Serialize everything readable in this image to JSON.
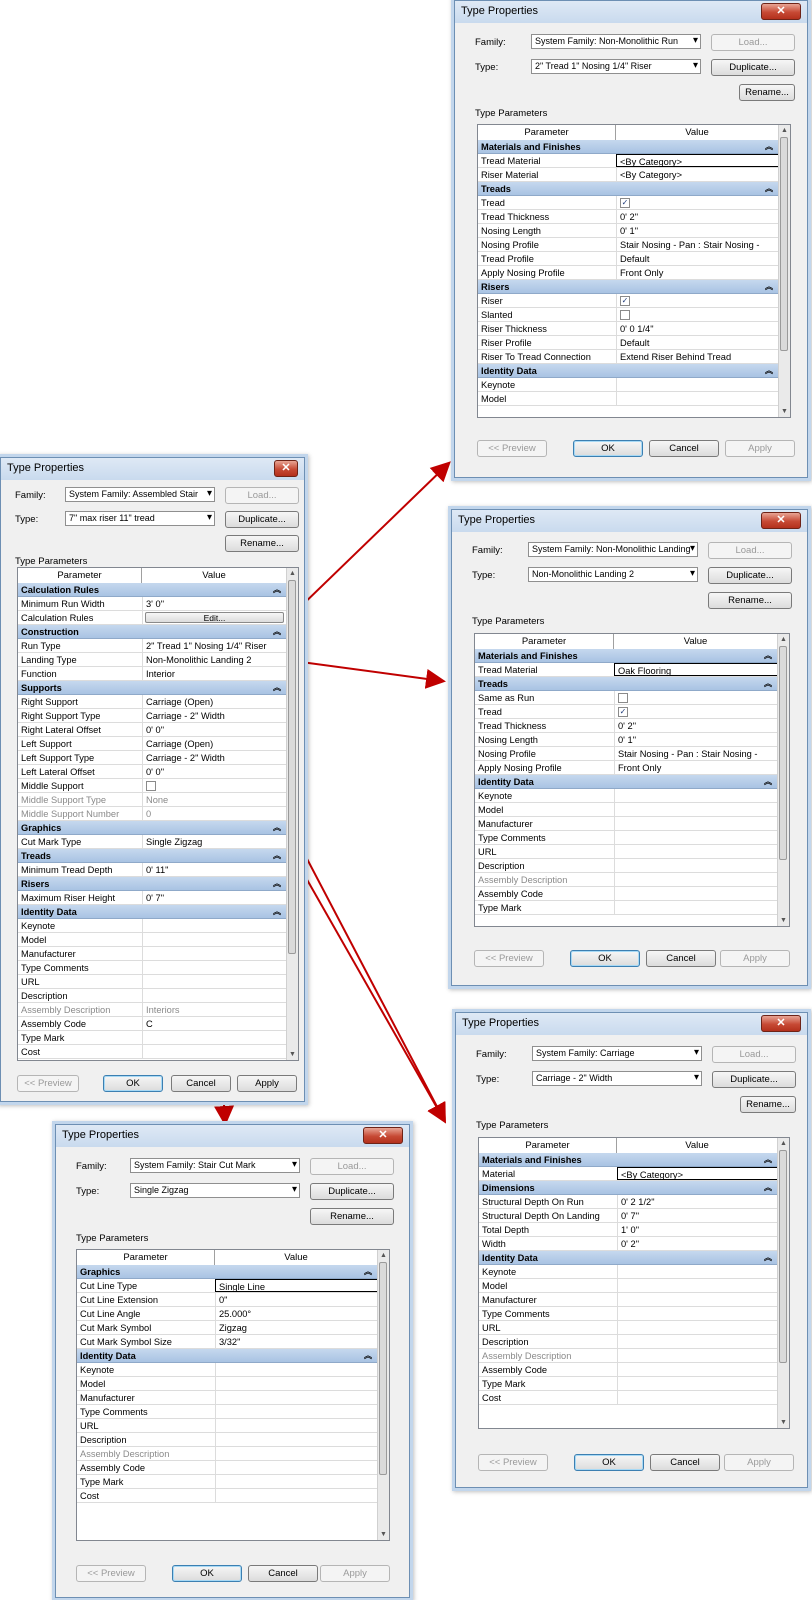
{
  "common": {
    "title": "Type Properties",
    "close_glyph": "✕",
    "family_label": "Family:",
    "type_label": "Type:",
    "load": "Load...",
    "duplicate": "Duplicate...",
    "rename": "Rename...",
    "type_parameters": "Type Parameters",
    "col_parameter": "Parameter",
    "col_value": "Value",
    "preview": "<< Preview",
    "ok": "OK",
    "cancel": "Cancel",
    "apply": "Apply"
  },
  "dialogs": {
    "run": {
      "family": "System Family: Non-Monolithic Run",
      "type": "2\" Tread 1\" Nosing 1/4\" Riser",
      "rows": [
        {
          "g": "Materials and Finishes"
        },
        {
          "p": "Tread Material",
          "v": "<By Category>",
          "sel": true
        },
        {
          "p": "Riser Material",
          "v": "<By Category>"
        },
        {
          "g": "Treads"
        },
        {
          "p": "Tread",
          "chk": true
        },
        {
          "p": "Tread Thickness",
          "v": "0'  2\""
        },
        {
          "p": "Nosing Length",
          "v": "0'  1\""
        },
        {
          "p": "Nosing Profile",
          "v": "Stair Nosing - Pan : Stair Nosing -"
        },
        {
          "p": "Tread Profile",
          "v": "Default"
        },
        {
          "p": "Apply Nosing Profile",
          "v": "Front Only"
        },
        {
          "g": "Risers"
        },
        {
          "p": "Riser",
          "chk": true
        },
        {
          "p": "Slanted",
          "chk": false
        },
        {
          "p": "Riser Thickness",
          "v": "0'  0 1/4\""
        },
        {
          "p": "Riser Profile",
          "v": "Default"
        },
        {
          "p": "Riser To Tread Connection",
          "v": "Extend Riser Behind Tread"
        },
        {
          "g": "Identity Data"
        },
        {
          "p": "Keynote",
          "v": ""
        },
        {
          "p": "Model",
          "v": ""
        }
      ]
    },
    "landing": {
      "family": "System Family: Non-Monolithic Landing",
      "type": "Non-Monolithic Landing 2",
      "rows": [
        {
          "g": "Materials and Finishes"
        },
        {
          "p": "Tread Material",
          "v": "Oak Flooring",
          "sel": true
        },
        {
          "g": "Treads"
        },
        {
          "p": "Same as Run",
          "chk": false
        },
        {
          "p": "Tread",
          "chk": true
        },
        {
          "p": "Tread Thickness",
          "v": "0'  2\""
        },
        {
          "p": "Nosing Length",
          "v": "0'  1\""
        },
        {
          "p": "Nosing Profile",
          "v": "Stair Nosing - Pan : Stair Nosing -"
        },
        {
          "p": "Apply Nosing Profile",
          "v": "Front Only"
        },
        {
          "g": "Identity Data"
        },
        {
          "p": "Keynote",
          "v": ""
        },
        {
          "p": "Model",
          "v": ""
        },
        {
          "p": "Manufacturer",
          "v": ""
        },
        {
          "p": "Type Comments",
          "v": ""
        },
        {
          "p": "URL",
          "v": ""
        },
        {
          "p": "Description",
          "v": ""
        },
        {
          "p": "Assembly Description",
          "v": "",
          "gray": true
        },
        {
          "p": "Assembly Code",
          "v": ""
        },
        {
          "p": "Type Mark",
          "v": ""
        }
      ]
    },
    "stair": {
      "family": "System Family: Assembled Stair",
      "type": "7\" max riser 11\" tread",
      "rows": [
        {
          "g": "Calculation Rules"
        },
        {
          "p": "Minimum Run Width",
          "v": "3'  0\""
        },
        {
          "p": "Calculation Rules",
          "btn": "Edit..."
        },
        {
          "g": "Construction"
        },
        {
          "p": "Run Type",
          "v": "2\" Tread 1\" Nosing 1/4\" Riser"
        },
        {
          "p": "Landing Type",
          "v": "Non-Monolithic Landing 2"
        },
        {
          "p": "Function",
          "v": "Interior"
        },
        {
          "g": "Supports"
        },
        {
          "p": "Right Support",
          "v": "Carriage (Open)"
        },
        {
          "p": "Right Support Type",
          "v": "Carriage - 2\" Width"
        },
        {
          "p": "Right Lateral Offset",
          "v": "0'  0\""
        },
        {
          "p": "Left Support",
          "v": "Carriage (Open)"
        },
        {
          "p": "Left Support Type",
          "v": "Carriage - 2\" Width"
        },
        {
          "p": "Left Lateral Offset",
          "v": "0'  0\""
        },
        {
          "p": "Middle Support",
          "chk": false
        },
        {
          "p": "Middle Support Type",
          "v": "None",
          "gray": true
        },
        {
          "p": "Middle Support Number",
          "v": "0",
          "gray": true
        },
        {
          "g": "Graphics"
        },
        {
          "p": "Cut Mark Type",
          "v": "Single Zigzag"
        },
        {
          "g": "Treads"
        },
        {
          "p": "Minimum Tread Depth",
          "v": "0'  11\""
        },
        {
          "g": "Risers"
        },
        {
          "p": "Maximum Riser Height",
          "v": "0'  7\""
        },
        {
          "g": "Identity Data"
        },
        {
          "p": "Keynote",
          "v": ""
        },
        {
          "p": "Model",
          "v": ""
        },
        {
          "p": "Manufacturer",
          "v": ""
        },
        {
          "p": "Type Comments",
          "v": ""
        },
        {
          "p": "URL",
          "v": ""
        },
        {
          "p": "Description",
          "v": ""
        },
        {
          "p": "Assembly Description",
          "v": "Interiors",
          "gray": true
        },
        {
          "p": "Assembly Code",
          "v": "C"
        },
        {
          "p": "Type Mark",
          "v": ""
        },
        {
          "p": "Cost",
          "v": ""
        }
      ]
    },
    "carriage": {
      "family": "System Family: Carriage",
      "type": "Carriage - 2\" Width",
      "rows": [
        {
          "g": "Materials and Finishes"
        },
        {
          "p": "Material",
          "v": "<By Category>",
          "sel": true
        },
        {
          "g": "Dimensions"
        },
        {
          "p": "Structural Depth On Run",
          "v": "0'  2 1/2\""
        },
        {
          "p": "Structural Depth On Landing",
          "v": "0'  7\""
        },
        {
          "p": "Total Depth",
          "v": "1'  0\""
        },
        {
          "p": "Width",
          "v": "0'  2\""
        },
        {
          "g": "Identity Data"
        },
        {
          "p": "Keynote",
          "v": ""
        },
        {
          "p": "Model",
          "v": ""
        },
        {
          "p": "Manufacturer",
          "v": ""
        },
        {
          "p": "Type Comments",
          "v": ""
        },
        {
          "p": "URL",
          "v": ""
        },
        {
          "p": "Description",
          "v": ""
        },
        {
          "p": "Assembly Description",
          "v": "",
          "gray": true
        },
        {
          "p": "Assembly Code",
          "v": ""
        },
        {
          "p": "Type Mark",
          "v": ""
        },
        {
          "p": "Cost",
          "v": ""
        }
      ]
    },
    "cutmark": {
      "family": "System Family: Stair Cut Mark",
      "type": "Single Zigzag",
      "rows": [
        {
          "g": "Graphics"
        },
        {
          "p": "Cut Line Type",
          "v": "Single Line",
          "sel": true
        },
        {
          "p": "Cut Line Extension",
          "v": "0\""
        },
        {
          "p": "Cut Line Angle",
          "v": "25.000°"
        },
        {
          "p": "Cut Mark Symbol",
          "v": "Zigzag"
        },
        {
          "p": "Cut Mark Symbol Size",
          "v": "3/32\""
        },
        {
          "g": "Identity Data"
        },
        {
          "p": "Keynote",
          "v": ""
        },
        {
          "p": "Model",
          "v": ""
        },
        {
          "p": "Manufacturer",
          "v": ""
        },
        {
          "p": "Type Comments",
          "v": ""
        },
        {
          "p": "URL",
          "v": ""
        },
        {
          "p": "Description",
          "v": ""
        },
        {
          "p": "Assembly Description",
          "v": "",
          "gray": true
        },
        {
          "p": "Assembly Code",
          "v": ""
        },
        {
          "p": "Type Mark",
          "v": ""
        },
        {
          "p": "Cost",
          "v": ""
        }
      ]
    }
  },
  "colors": {
    "arrow": "#c00000",
    "group_header": "#b3cbe8"
  }
}
